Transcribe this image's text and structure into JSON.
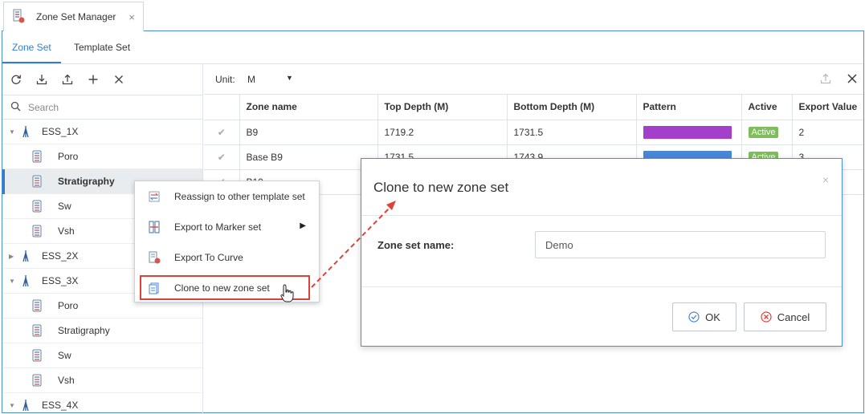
{
  "window": {
    "tab_title": "Zone Set Manager",
    "tab_close": "×"
  },
  "subtabs": [
    {
      "label": "Zone Set",
      "active": true
    },
    {
      "label": "Template Set",
      "active": false
    }
  ],
  "left_toolbar": {
    "icons": [
      "refresh-icon",
      "import-icon",
      "export-icon",
      "add-icon",
      "close-icon"
    ]
  },
  "search": {
    "placeholder": "Search"
  },
  "tree": [
    {
      "label": "ESS_1X",
      "type": "well",
      "expanded": true
    },
    {
      "label": "Poro",
      "type": "zone"
    },
    {
      "label": "Stratigraphy",
      "type": "zone",
      "selected": true
    },
    {
      "label": "Sw",
      "type": "zone"
    },
    {
      "label": "Vsh",
      "type": "zone"
    },
    {
      "label": "ESS_2X",
      "type": "well",
      "expanded": false
    },
    {
      "label": "ESS_3X",
      "type": "well",
      "expanded": true
    },
    {
      "label": "Poro",
      "type": "zone"
    },
    {
      "label": "Stratigraphy",
      "type": "zone"
    },
    {
      "label": "Sw",
      "type": "zone"
    },
    {
      "label": "Vsh",
      "type": "zone"
    },
    {
      "label": "ESS_4X",
      "type": "well",
      "expanded": true
    }
  ],
  "right_toolbar": {
    "unit_label": "Unit:",
    "unit_value": "M",
    "unit_arrow": "▼"
  },
  "table": {
    "columns": [
      "",
      "Zone name",
      "Top Depth (M)",
      "Bottom Depth (M)",
      "Pattern",
      "Active",
      "Export Value"
    ],
    "rows": [
      {
        "check": "✔",
        "name": "B9",
        "top": "1719.2",
        "bottom": "1731.5",
        "color": "#a43fcc",
        "active": "Active",
        "export": "2"
      },
      {
        "check": "✔",
        "name": "Base B9",
        "top": "1731.5",
        "bottom": "1743.9",
        "color": "#4a87d8",
        "active": "Active",
        "export": "3"
      },
      {
        "check": "✔",
        "name": "B10",
        "top": "",
        "bottom": "",
        "color": "",
        "active": "",
        "export": ""
      }
    ]
  },
  "context_menu": {
    "items": [
      {
        "label": "Reassign to other template set",
        "icon": "reassign-icon"
      },
      {
        "label": "Export to Marker set",
        "icon": "marker-export-icon",
        "submenu": "▶"
      },
      {
        "label": "Export To Curve",
        "icon": "curve-export-icon"
      },
      {
        "label": "Clone to new zone set",
        "icon": "clone-icon",
        "highlighted": true
      }
    ]
  },
  "dialog": {
    "title": "Clone to new zone set",
    "close": "×",
    "field_label": "Zone set name:",
    "field_value": "Demo",
    "ok_label": "OK",
    "cancel_label": "Cancel"
  },
  "colors": {
    "accent": "#2f7fd0",
    "highlight": "#e0403a",
    "active_badge": "#7dbe5b",
    "border_blue": "#4a8fd1"
  }
}
